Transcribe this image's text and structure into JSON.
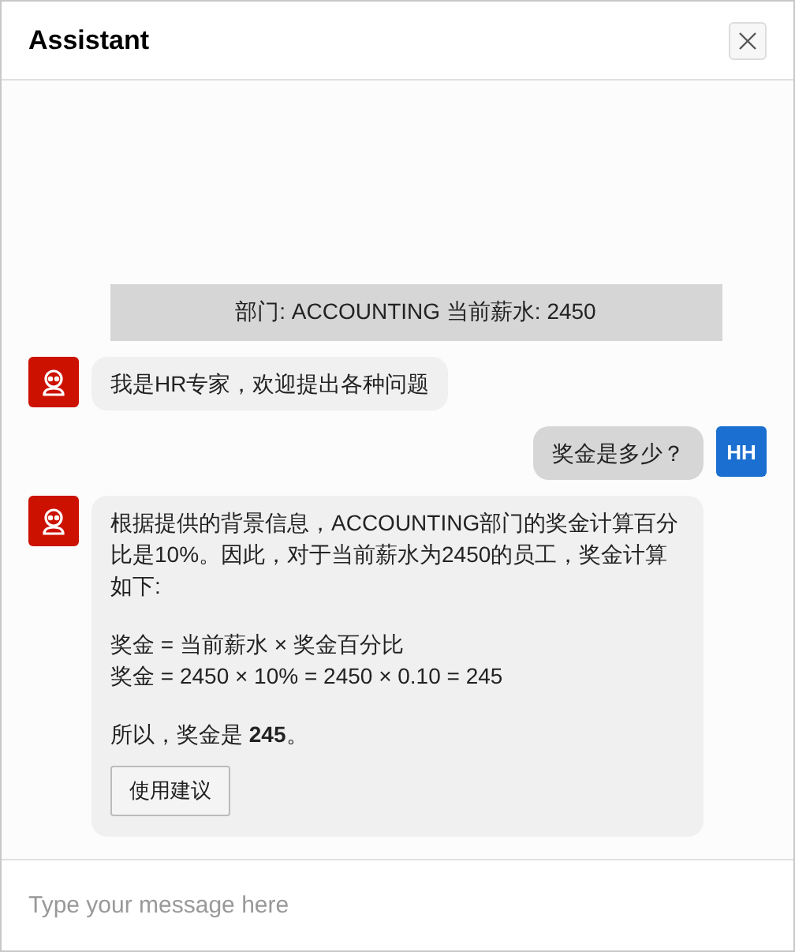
{
  "window": {
    "title": "Assistant"
  },
  "messages": [
    {
      "kind": "context",
      "text": "部门: ACCOUNTING 当前薪水: 2450"
    },
    {
      "kind": "bot",
      "paragraphs": [
        {
          "lines": [
            "我是HR专家，欢迎提出各种问题"
          ]
        }
      ]
    },
    {
      "kind": "user",
      "avatar": "HH",
      "paragraphs": [
        {
          "lines": [
            "奖金是多少？"
          ]
        }
      ]
    },
    {
      "kind": "bot",
      "paragraphs": [
        {
          "lines": [
            "根据提供的背景信息，ACCOUNTING部门的奖金计算百分比是10%。因此，对于当前薪水为2450的员工，奖金计算如下:"
          ]
        },
        {
          "lines": [
            "奖金 = 当前薪水 × 奖金百分比",
            "奖金 = 2450 × 10% = 2450 × 0.10 = 245"
          ]
        },
        {
          "lines": [
            "所以，奖金是 **245**。"
          ]
        }
      ],
      "action": "使用建议"
    }
  ],
  "input": {
    "placeholder": "Type your message here"
  }
}
